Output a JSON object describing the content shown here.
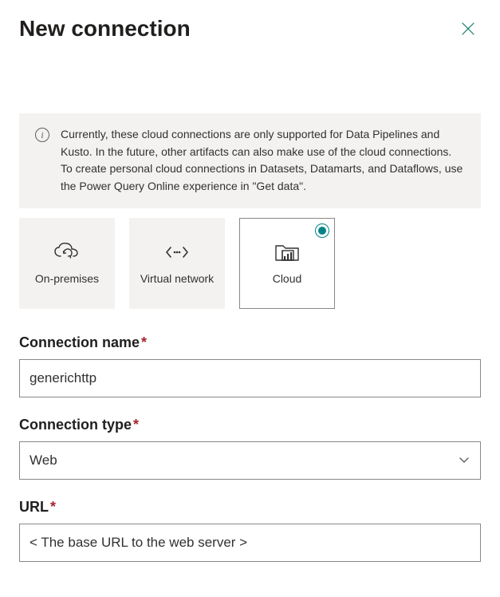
{
  "header": {
    "title": "New connection"
  },
  "info": {
    "text": "Currently, these cloud connections are only supported for Data Pipelines and Kusto. In the future, other artifacts can also make use of the cloud connections. To create personal cloud connections in Datasets, Datamarts, and Dataflows, use the Power Query Online experience in \"Get data\"."
  },
  "tiles": {
    "onprem": {
      "label": "On-premises"
    },
    "vnet": {
      "label": "Virtual network"
    },
    "cloud": {
      "label": "Cloud"
    }
  },
  "fields": {
    "connection_name": {
      "label": "Connection name",
      "value": "generichttp"
    },
    "connection_type": {
      "label": "Connection type",
      "value": "Web"
    },
    "url": {
      "label": "URL",
      "value": "< The base URL to the web server >"
    }
  }
}
